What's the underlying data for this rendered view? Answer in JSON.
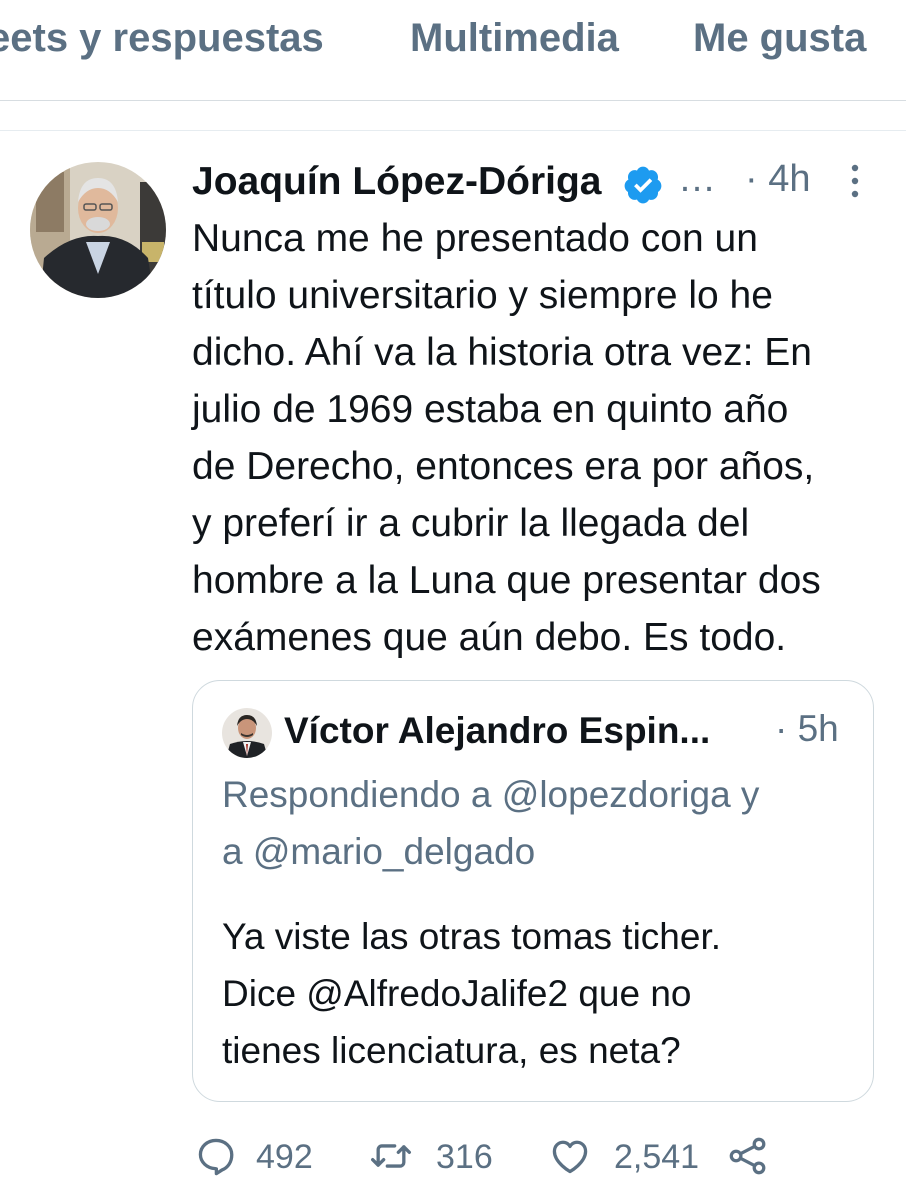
{
  "tabs": [
    "eets y respuestas",
    "Multimedia",
    "Me gusta"
  ],
  "tweet": {
    "author": "Joaquín López-Dóriga",
    "ellipsis": "…",
    "time": "· 4h",
    "body_lines": [
      "Nunca me he presentado con un",
      "título universitario y siempre lo he",
      "dicho. Ahí va la historia otra vez: En",
      "julio de 1969 estaba en quinto año",
      "de Derecho, entonces era por años,",
      "y preferí ir a cubrir la llegada del",
      "hombre a la Luna que presentar dos",
      "exámenes que aún debo. Es todo."
    ]
  },
  "quoted": {
    "author": "Víctor Alejandro Espin...",
    "time": "· 5h",
    "reply_lines": [
      "Respondiendo a @lopezdoriga y",
      "a @mario_delgado"
    ],
    "text_lines": [
      "Ya viste las otras tomas ticher.",
      "Dice @AlfredoJalife2 que no",
      "tienes licenciatura, es neta?"
    ]
  },
  "actions": {
    "replies": "492",
    "retweets": "316",
    "likes": "2,541"
  },
  "colors": {
    "accent": "#1d9bf0",
    "muted": "#5b7083",
    "text": "#0f1419"
  },
  "icons": [
    "verified-badge-icon",
    "more-options-icon",
    "reply-icon",
    "retweet-icon",
    "like-icon",
    "share-icon"
  ]
}
